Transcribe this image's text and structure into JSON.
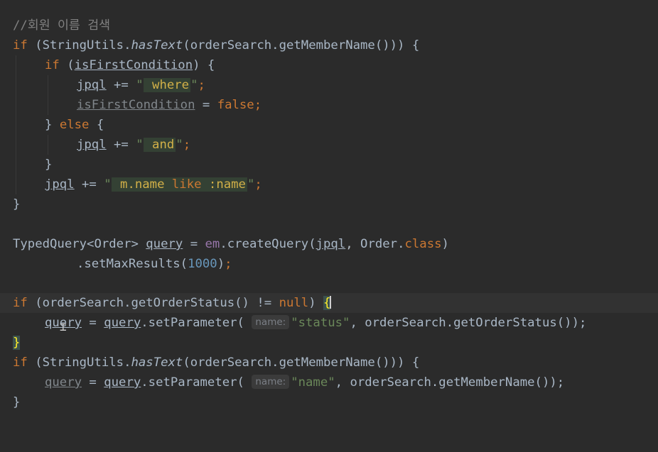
{
  "editor": {
    "comment": "//회원 이름 검색",
    "line_if1_a": "if",
    "line_if1_b": " (StringUtils.",
    "line_if1_c": "hasText",
    "line_if1_d": "(orderSearch.getMemberName())) {",
    "if2_kw": "if",
    "if2_a": " (",
    "if2_var": "isFirstCondition",
    "if2_b": ") {",
    "jpql": "jpql",
    "plus_eq": " += ",
    "q": "\"",
    "where": " where",
    "semi_q": "\";",
    "isFirst2": "isFirstCondition",
    "eq": " = ",
    "false_kw": "false",
    "semi": ";",
    "else_brace": "} ",
    "else_kw": "else",
    "else_open": " {",
    "and": " and",
    "close": "}",
    "name_like_a": " m.name ",
    "like": "like",
    "name_like_b": " :name",
    "typed_a": "TypedQuery<Order> ",
    "query": "query",
    "em": "em",
    "create_a": ".createQuery(",
    "create_b": ", Order.",
    "class_kw": "class",
    "create_c": ")",
    "setmax_a": ".setMaxResults(",
    "setmax_num": "1000",
    "setmax_b": ");",
    "if3_b": " (orderSearch.getOrderStatus() != ",
    "null_kw": "null",
    "if3_c": ") ",
    "open_brace": "{",
    "setp": ".setParameter( ",
    "hint_name": "name:",
    "status_str": "\"status\"",
    "setp_status_tail": ", orderSearch.getOrderStatus());",
    "name_str": "\"name\"",
    "setp_name_tail": ", orderSearch.getMemberName());",
    "close_brace_hl": "}"
  }
}
